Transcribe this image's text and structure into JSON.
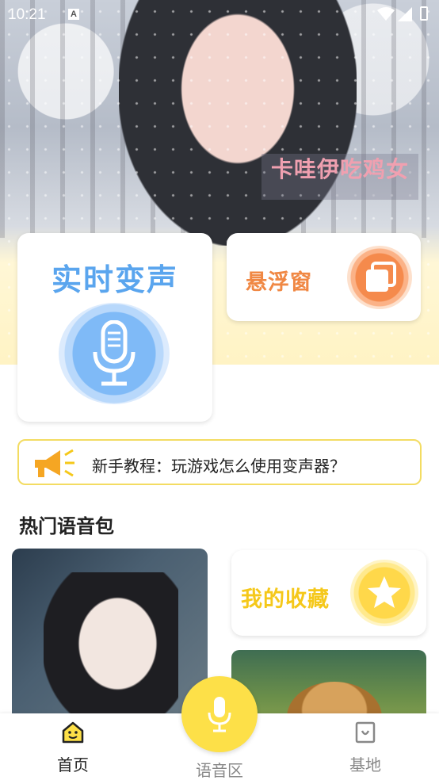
{
  "status_bar": {
    "time": "10:21",
    "notification_icon": "A"
  },
  "hero": {
    "tag_text": "卡哇伊吃鸡女"
  },
  "cards": {
    "realtime": {
      "title": "实时变声",
      "icon": "microphone-icon",
      "color": "#5aa5ee"
    },
    "float_window": {
      "title": "悬浮窗",
      "icon": "overlay-window-icon",
      "color": "#f08844"
    }
  },
  "tutorial": {
    "icon": "megaphone-icon",
    "text": "新手教程：玩游戏怎么使用变声器？"
  },
  "hot_section": {
    "title": "热门语音包"
  },
  "favorites": {
    "title": "我的收藏",
    "icon": "star-icon",
    "color": "#f5c81a"
  },
  "bottom_nav": {
    "home": {
      "label": "首页",
      "icon": "home-smile-icon"
    },
    "voice": {
      "label": "语音区",
      "icon": "microphone-icon"
    },
    "base": {
      "label": "基地",
      "icon": "base-tag-icon"
    }
  }
}
